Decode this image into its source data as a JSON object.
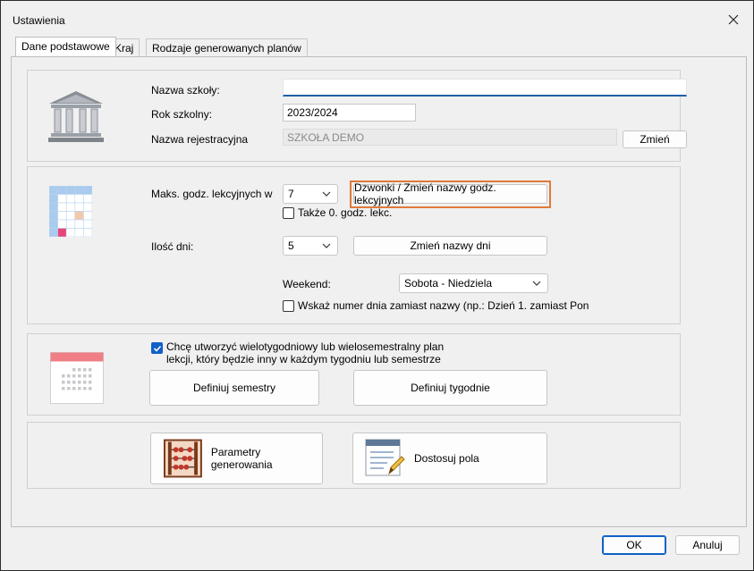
{
  "window": {
    "title": "Ustawienia"
  },
  "tabs": [
    {
      "label": "Dane podstawowe",
      "active": true
    },
    {
      "label": "Kraj",
      "active": false
    },
    {
      "label": "Rodzaje generowanych planów",
      "active": false
    }
  ],
  "school": {
    "name_label": "Nazwa szkoły:",
    "name_value": "",
    "year_label": "Rok szkolny:",
    "year_value": "2023/2024",
    "reg_label": "Nazwa rejestracyjna",
    "reg_value": "SZKOŁA DEMO",
    "change_label": "Zmień"
  },
  "lessons": {
    "max_label": "Maks. godz. lekcyjnych w",
    "max_value": "7",
    "bells_label": "Dzwonki / Zmień nazwy godz. lekcyjnych",
    "zero_label": "Także 0. godz. lekc.",
    "days_label": "Ilość dni:",
    "days_value": "5",
    "rename_days_label": "Zmień nazwy dni",
    "weekend_label": "Weekend:",
    "weekend_value": "Sobota - Niedziela",
    "day_number_label": "Wskaż numer dnia zamiast nazwy (np.: Dzień 1. zamiast Pon"
  },
  "multiweek": {
    "checkbox_label_line1": "Chcę utworzyć wielotygodniowy lub wielosemestralny plan",
    "checkbox_label_line2": "lekcji, który będzie inny w każdym tygodniu lub semestrze",
    "define_semesters": "Definiuj semestry",
    "define_weeks": "Definiuj tygodnie"
  },
  "tools": {
    "params_label": "Parametry generowania",
    "fields_label": "Dostosuj pola"
  },
  "footer": {
    "ok": "OK",
    "cancel": "Anuluj"
  },
  "colors": {
    "accent": "#1060c8",
    "highlight": "#e07a3a",
    "pink": "#e8457a",
    "peach": "#f3c8a8"
  }
}
